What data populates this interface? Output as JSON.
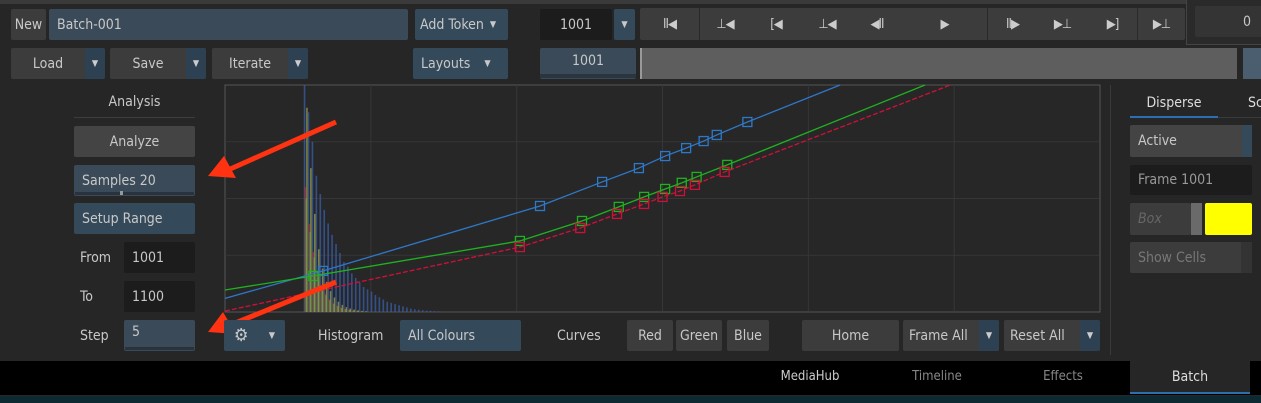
{
  "toolbar": {
    "new_label": "New",
    "batch_name": "Batch-001",
    "add_token_label": "Add Token",
    "frame_value": "1001",
    "load_label": "Load",
    "save_label": "Save",
    "iterate_label": "Iterate",
    "layouts_label": "Layouts",
    "frame_slider_value": "1001",
    "counter_value": "0"
  },
  "transport": [
    {
      "icon": "go-to-start-icon",
      "glyph": "II◀"
    },
    {
      "icon": "previous-keyframe-icon",
      "glyph": "⊥◀"
    },
    {
      "icon": "go-to-in-point-icon",
      "glyph": "[◀"
    },
    {
      "icon": "step-back-icon",
      "glyph": "⊥◀"
    },
    {
      "icon": "play-backward-icon",
      "glyph": "◀II"
    },
    {
      "icon": "play-icon",
      "glyph": "▶"
    },
    {
      "icon": "step-forward-icon",
      "glyph": "II▶"
    },
    {
      "icon": "next-frame-icon",
      "glyph": "▶⊥"
    },
    {
      "icon": "go-to-out-point-icon",
      "glyph": "▶]"
    },
    {
      "icon": "go-to-end-icon",
      "glyph": "▶⊥"
    }
  ],
  "analysis": {
    "title": "Analysis",
    "analyze_label": "Analyze",
    "samples_label": "Samples 20",
    "samples_value": 20,
    "setup_range_label": "Setup Range",
    "from_label": "From",
    "from_value": "1001",
    "to_label": "To",
    "to_value": "1100",
    "step_label": "Step",
    "step_value": "5"
  },
  "graph_toolbar": {
    "histogram_label": "Histogram",
    "histogram_mode": "All Colours",
    "curves_label": "Curves",
    "red_label": "Red",
    "green_label": "Green",
    "blue_label": "Blue",
    "home_label": "Home",
    "frame_all_label": "Frame All",
    "reset_all_label": "Reset All"
  },
  "right_panel": {
    "tabs": [
      "Disperse",
      "Sc"
    ],
    "active_label": "Active",
    "frame_label": "Frame 1001",
    "box_label": "Box",
    "box_color": "#ffff00",
    "show_cells_label": "Show Cells"
  },
  "bottom_tabs": [
    "MediaHub",
    "Timeline",
    "Effects",
    "Batch"
  ],
  "colors": {
    "accent": "#2a6fb0",
    "red_curve": "#d0103a",
    "green_curve": "#1fb21f",
    "blue_curve": "#2e78c8",
    "annotation_arrow": "#ff3311"
  },
  "chart_data": {
    "type": "line",
    "xlim": [
      0,
      1
    ],
    "ylim": [
      0,
      1
    ],
    "grid": true,
    "series": [
      {
        "name": "Blue",
        "color": "#2e78c8",
        "points": [
          [
            0,
            0.06
          ],
          [
            0.112,
            0.181
          ],
          [
            0.36,
            0.467
          ],
          [
            0.431,
            0.573
          ],
          [
            0.473,
            0.634
          ],
          [
            0.503,
            0.687
          ],
          [
            0.527,
            0.722
          ],
          [
            0.547,
            0.753
          ],
          [
            0.562,
            0.78
          ],
          [
            0.597,
            0.837
          ],
          [
            0.703,
            1.0
          ]
        ],
        "markers": [
          1,
          2,
          3,
          4,
          5,
          6,
          7,
          8,
          9
        ]
      },
      {
        "name": "Green",
        "color": "#1fb21f",
        "points": [
          [
            0,
            0.097
          ],
          [
            0.101,
            0.159
          ],
          [
            0.337,
            0.313
          ],
          [
            0.408,
            0.401
          ],
          [
            0.45,
            0.463
          ],
          [
            0.479,
            0.507
          ],
          [
            0.503,
            0.542
          ],
          [
            0.522,
            0.569
          ],
          [
            0.539,
            0.595
          ],
          [
            0.574,
            0.648
          ],
          [
            0.8,
            1.0
          ]
        ],
        "markers": [
          1,
          2,
          3,
          4,
          5,
          6,
          7,
          8,
          9
        ]
      },
      {
        "name": "Red",
        "color": "#d0103a",
        "points": [
          [
            0,
            0.004
          ],
          [
            0.337,
            0.286
          ],
          [
            0.406,
            0.37
          ],
          [
            0.448,
            0.432
          ],
          [
            0.479,
            0.476
          ],
          [
            0.5,
            0.507
          ],
          [
            0.52,
            0.533
          ],
          [
            0.537,
            0.56
          ],
          [
            0.571,
            0.617
          ],
          [
            0.829,
            1.0
          ]
        ],
        "markers": [
          1,
          2,
          3,
          4,
          5,
          6,
          7,
          8
        ]
      }
    ],
    "histogram": {
      "start": 0.09,
      "bin_width": 0.0045,
      "values": [
        1.0,
        0.88,
        0.75,
        0.6,
        0.52,
        0.45,
        0.39,
        0.34,
        0.3,
        0.26,
        0.22,
        0.2,
        0.17,
        0.15,
        0.13,
        0.11,
        0.1,
        0.09,
        0.075,
        0.065,
        0.055,
        0.045,
        0.04,
        0.035,
        0.03,
        0.025,
        0.02,
        0.015,
        0.012,
        0.01,
        0.008,
        0.006,
        0.005,
        0.004,
        0.003
      ]
    }
  }
}
